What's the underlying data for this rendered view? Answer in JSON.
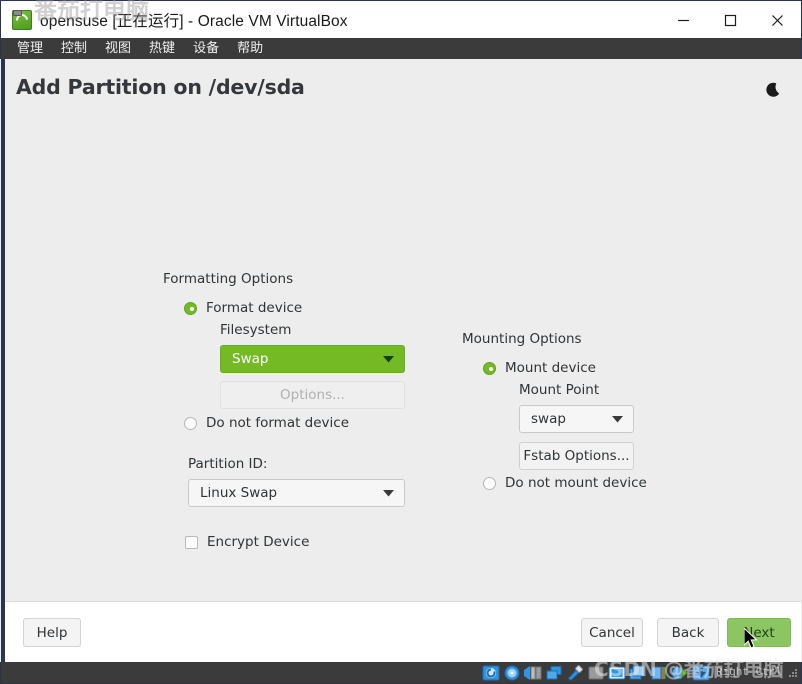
{
  "window": {
    "title": "opensuse [正在运行] - Oracle VM VirtualBox",
    "app_icon": "opensuse-geeko-icon",
    "controls": {
      "minimize": "minimize-button",
      "maximize": "maximize-button",
      "close": "close-button"
    }
  },
  "menubar": {
    "items": [
      {
        "label": "管理"
      },
      {
        "label": "控制"
      },
      {
        "label": "视图"
      },
      {
        "label": "热键"
      },
      {
        "label": "设备"
      },
      {
        "label": "帮助"
      }
    ]
  },
  "dialog": {
    "title": "Add Partition on /dev/sda",
    "dark_mode_icon": "moon-icon"
  },
  "formatting": {
    "group_label": "Formatting Options",
    "format_device": {
      "label": "Format device",
      "selected": true
    },
    "filesystem_label": "Filesystem",
    "filesystem_value": "Swap",
    "filesystem_accent": "#73ba25",
    "options_button": "Options...",
    "options_button_enabled": false,
    "do_not_format": {
      "label": "Do not format device",
      "selected": false
    },
    "partition_id_label": "Partition ID:",
    "partition_id_value": "Linux Swap",
    "encrypt_device": {
      "label": "Encrypt Device",
      "checked": false
    }
  },
  "mounting": {
    "group_label": "Mounting Options",
    "mount_device": {
      "label": "Mount device",
      "selected": true
    },
    "mount_point_label": "Mount Point",
    "mount_point_value": "swap",
    "fstab_button": "Fstab Options...",
    "do_not_mount": {
      "label": "Do not mount device",
      "selected": false
    }
  },
  "footer": {
    "help": "Help",
    "cancel": "Cancel",
    "back": "Back",
    "next": "Next",
    "next_color": "#8cc662"
  },
  "statusbar": {
    "hint": "Right Ctrl",
    "icons": [
      "harddisk-icon",
      "optical-disk-icon",
      "floppy-icon",
      "network-icon",
      "usb-icon",
      "shared-folder-icon",
      "display-icon",
      "recording-icon",
      "features-icon",
      "mouse-icon",
      "keyboard-icon"
    ]
  },
  "watermark": {
    "top": "番茄打电脑",
    "bottom": "CSDN @番茄打电脑"
  }
}
